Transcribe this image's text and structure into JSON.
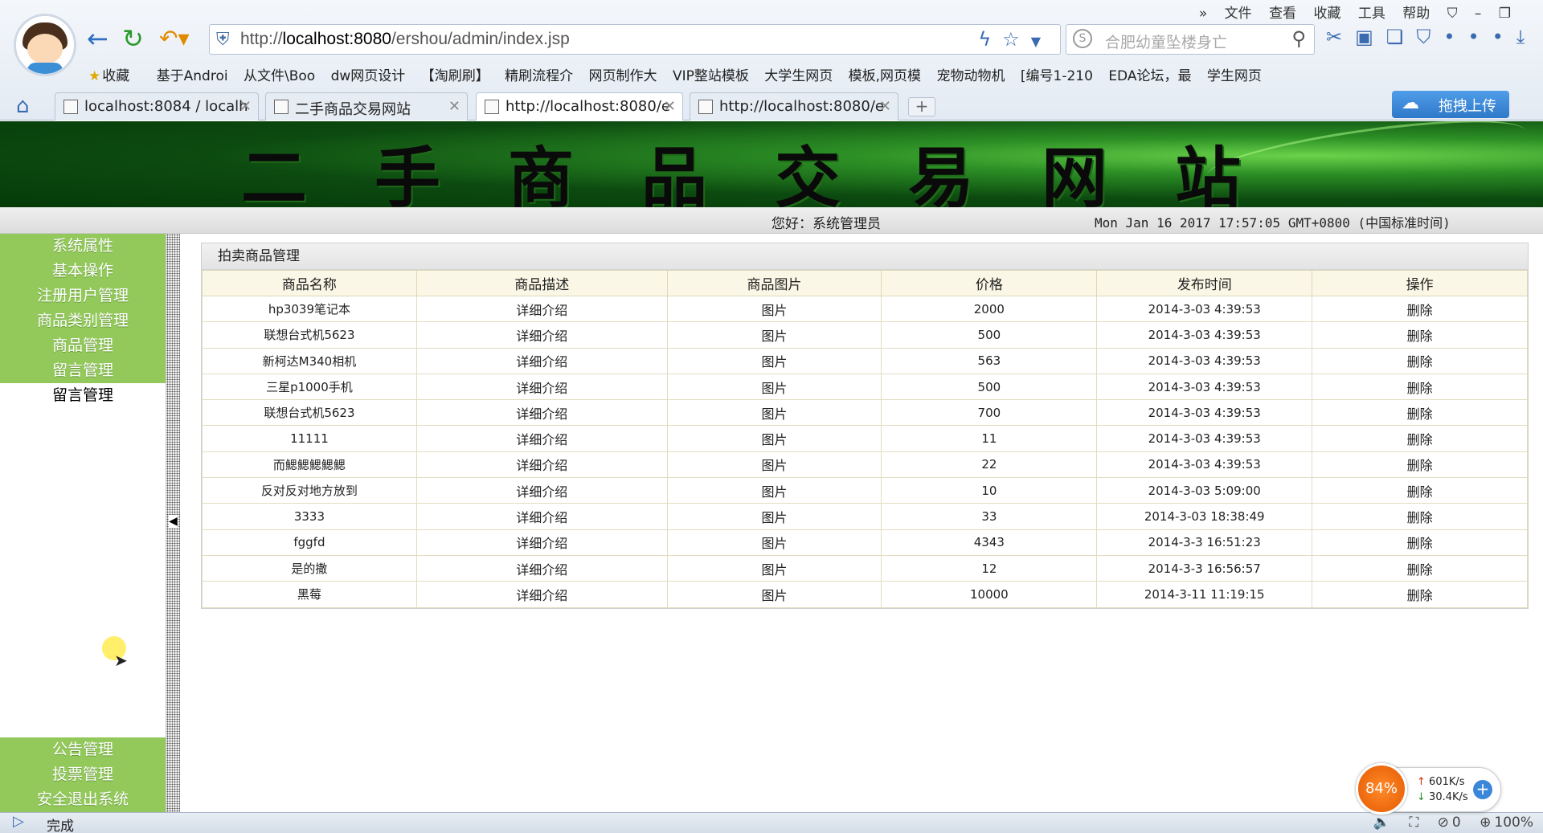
{
  "browser": {
    "menu": [
      "文件",
      "查看",
      "收藏",
      "工具",
      "帮助"
    ],
    "url_prefix": "http://",
    "url_host": "localhost:8080",
    "url_path": "/ershou/admin/index.jsp",
    "search_placeholder": "合肥幼童坠楼身亡",
    "bookmarks": [
      "收藏",
      "基于Androi",
      "从文件\\Boo",
      "dw网页设计",
      "【淘刷刷】",
      "精刷流程介",
      "网页制作大",
      "VIP整站模板",
      "大学生网页",
      "模板,网页模",
      "宠物动物机",
      "[编号1-210",
      "EDA论坛，最",
      "学生网页"
    ],
    "tabs": [
      {
        "label": "localhost:8084 / localh",
        "active": false
      },
      {
        "label": "二手商品交易网站",
        "active": false
      },
      {
        "label": "http://localhost:8080/e",
        "active": true
      },
      {
        "label": "http://localhost:8080/e",
        "active": false
      }
    ],
    "upload_label": "拖拽上传",
    "status_text": "完成",
    "status_right": [
      "0",
      "100%"
    ],
    "speed": {
      "percent": "84%",
      "up": "601K/s",
      "down": "30.4K/s"
    }
  },
  "site": {
    "banner_title": "二手商品交易网站",
    "greeting": "您好：系统管理员",
    "timestamp": "Mon Jan 16 2017 17:57:05 GMT+0800 (中国标准时间)"
  },
  "sidebar": {
    "top_items": [
      "系统属性",
      "基本操作",
      "注册用户管理",
      "商品类别管理",
      "商品管理",
      "留言管理"
    ],
    "plain_item": "留言管理",
    "bottom_items": [
      "公告管理",
      "投票管理",
      "安全退出系统"
    ]
  },
  "panel": {
    "title": "拍卖商品管理",
    "columns": [
      "商品名称",
      "商品描述",
      "商品图片",
      "价格",
      "发布时间",
      "操作"
    ],
    "rows": [
      [
        "hp3039笔记本",
        "详细介绍",
        "图片",
        "2000",
        "2014-3-03 4:39:53",
        "删除"
      ],
      [
        "联想台式机5623",
        "详细介绍",
        "图片",
        "500",
        "2014-3-03 4:39:53",
        "删除"
      ],
      [
        "新柯达M340相机",
        "详细介绍",
        "图片",
        "563",
        "2014-3-03 4:39:53",
        "删除"
      ],
      [
        "三星p1000手机",
        "详细介绍",
        "图片",
        "500",
        "2014-3-03 4:39:53",
        "删除"
      ],
      [
        "联想台式机5623",
        "详细介绍",
        "图片",
        "700",
        "2014-3-03 4:39:53",
        "删除"
      ],
      [
        "11111",
        "详细介绍",
        "图片",
        "11",
        "2014-3-03 4:39:53",
        "删除"
      ],
      [
        "而鰓鰓鰓鰓鰓",
        "详细介绍",
        "图片",
        "22",
        "2014-3-03 4:39:53",
        "删除"
      ],
      [
        "反对反对地方放到",
        "详细介绍",
        "图片",
        "10",
        "2014-3-03 5:09:00",
        "删除"
      ],
      [
        "3333",
        "详细介绍",
        "图片",
        "33",
        "2014-3-03 18:38:49",
        "删除"
      ],
      [
        "fggfd",
        "详细介绍",
        "图片",
        "4343",
        "2014-3-3 16:51:23",
        "删除"
      ],
      [
        "是的撒",
        "详细介绍",
        "图片",
        "12",
        "2014-3-3 16:56:57",
        "删除"
      ],
      [
        "黑莓",
        "详细介绍",
        "图片",
        "10000",
        "2014-3-11 11:19:15",
        "删除"
      ]
    ]
  }
}
